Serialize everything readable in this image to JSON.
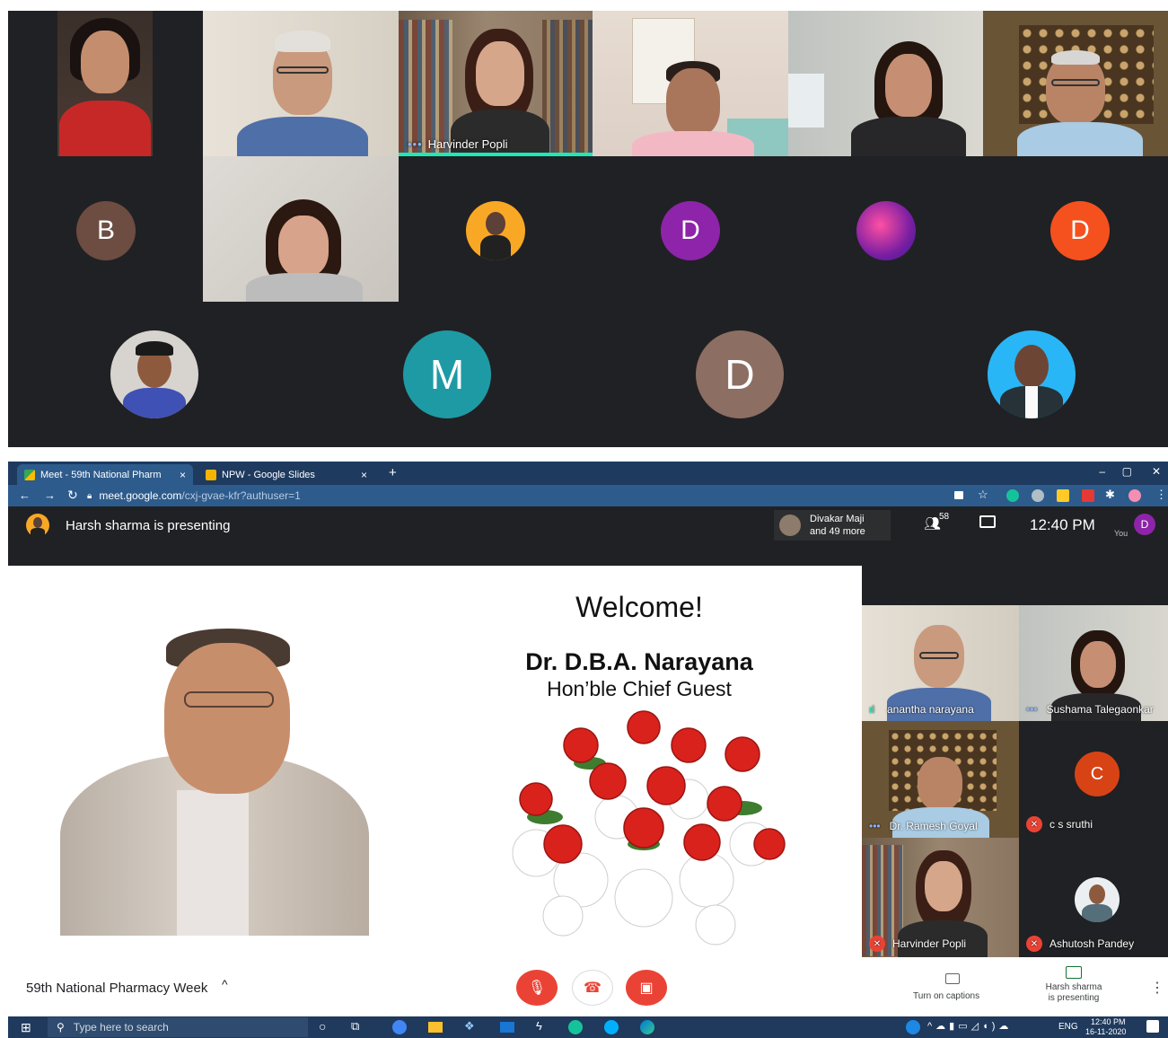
{
  "top_grid": {
    "active_speaker_name": "Harvinder Popli",
    "avatars": [
      {
        "letter": "B",
        "color": "#6d4c41"
      },
      {
        "letter": "D",
        "color": "#8e24aa"
      },
      {
        "letter": "D",
        "color": "#f4511e"
      },
      {
        "letter": "M",
        "color": "#1e9aa5"
      },
      {
        "letter": "D",
        "color": "#8d6e63"
      }
    ]
  },
  "browser": {
    "tabs": [
      {
        "label": "Meet - 59th National Pharm",
        "close": "×"
      },
      {
        "label": "NPW - Google Slides",
        "close": "×"
      }
    ],
    "new_tab": "+",
    "url_domain": "meet.google.com",
    "url_path": "/cxj-gvae-kfr?authuser=1",
    "window_controls": {
      "minimize": "–",
      "maximize": "▢",
      "close": "✕"
    }
  },
  "meet": {
    "presenting_banner": "Harsh sharma is presenting",
    "participant_preview": {
      "line1": "Divakar Maji",
      "line2": "and 49 more"
    },
    "participant_count": "58",
    "time": "12:40 PM",
    "you_label": "You",
    "you_avatar_letter": "D",
    "slide": {
      "heading": "Welcome!",
      "name": "Dr. D.B.A. Narayana",
      "subtitle": "Hon’ble Chief Guest"
    },
    "side_tiles": [
      {
        "name": "anantha narayana"
      },
      {
        "name": "Sushama Talegaonkar"
      },
      {
        "name": "Dr. Ramesh Goyal"
      },
      {
        "name": "c s sruthi",
        "letter": "C"
      },
      {
        "name": "Harvinder Popli"
      },
      {
        "name": "Ashutosh Pandey"
      }
    ],
    "meeting_title": "59th National Pharmacy Week",
    "captions_label": "Turn on captions",
    "present_label_1": "Harsh sharma",
    "present_label_2": "is presenting"
  },
  "taskbar": {
    "search_placeholder": "Type here to search",
    "lang": "ENG",
    "time": "12:40 PM",
    "date": "16-11-2020"
  },
  "colors": {
    "meet_dark": "#202124",
    "end_call_red": "#ea4335",
    "chrome_blue": "#2d5b8c",
    "active_speaker": "#1de9b6"
  }
}
